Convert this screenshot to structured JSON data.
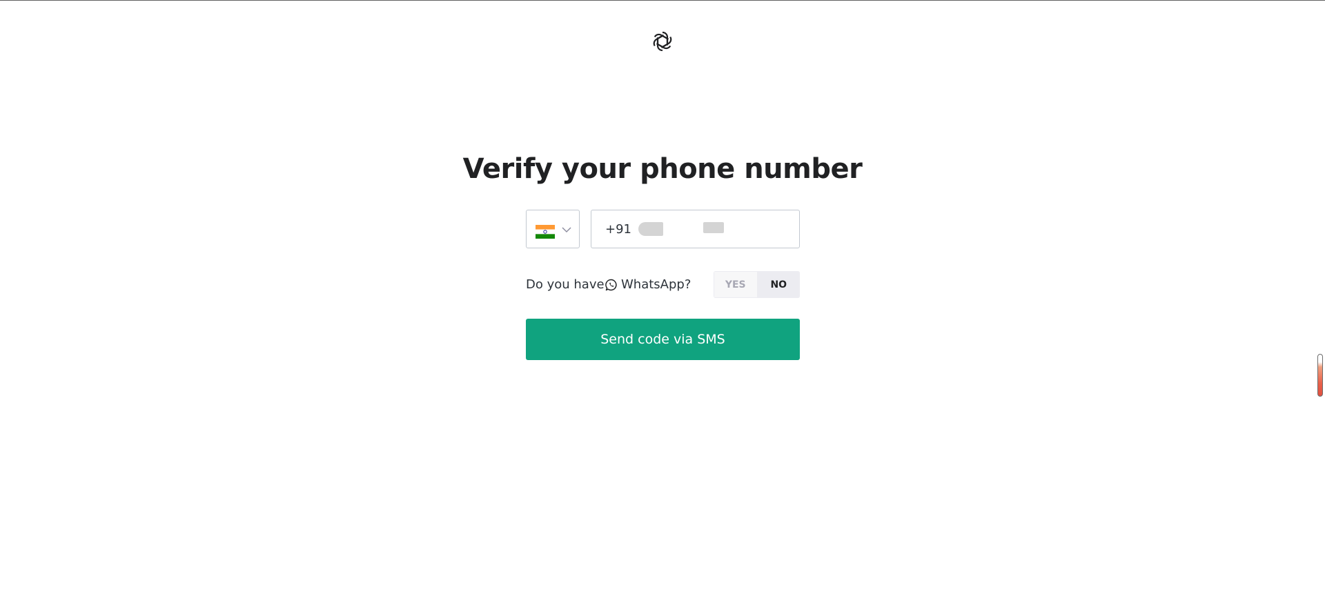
{
  "page": {
    "title": "Verify your phone number"
  },
  "logo": {
    "icon": "openai-logo-icon"
  },
  "country_select": {
    "selected_country": "India",
    "flag_icon": "india-flag-icon",
    "dropdown_icon": "chevron-down-icon"
  },
  "phone": {
    "dial_code": "+91",
    "value": ""
  },
  "whatsapp": {
    "prefix": "Do you have",
    "icon": "whatsapp-icon",
    "suffix": "WhatsApp?",
    "yes_label": "YES",
    "no_label": "NO",
    "selected": "NO"
  },
  "send_button": {
    "label": "Send code via SMS"
  },
  "colors": {
    "accent": "#10a37f",
    "text": "#202123",
    "border": "#c2c8d0"
  }
}
